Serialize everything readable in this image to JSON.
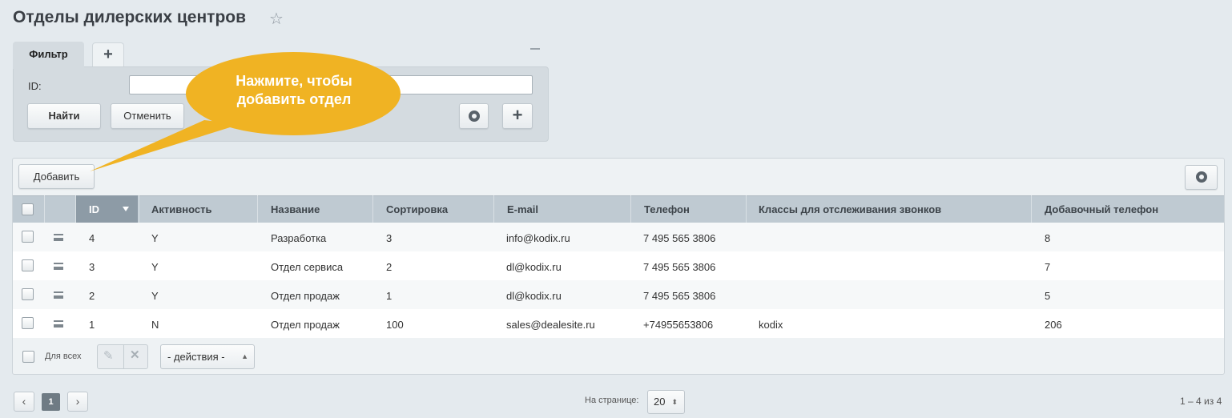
{
  "page": {
    "title": "Отделы дилерских центров"
  },
  "filter": {
    "tab_label": "Фильтр",
    "id_label": "ID:",
    "id_value": "",
    "find_label": "Найти",
    "cancel_label": "Отменить"
  },
  "callout": {
    "line1": "Нажмите, чтобы",
    "line2": "добавить отдел"
  },
  "toolbar": {
    "add_label": "Добавить"
  },
  "grid": {
    "columns": [
      "ID",
      "Активность",
      "Название",
      "Сортировка",
      "E-mail",
      "Телефон",
      "Классы для отслеживания звонков",
      "Добавочный телефон"
    ],
    "rows": [
      {
        "id": "4",
        "active": "Y",
        "name": "Разработка",
        "sort": "3",
        "email": "info@kodix.ru",
        "phone": "7 495 565 3806",
        "classes": "",
        "ext": "8"
      },
      {
        "id": "3",
        "active": "Y",
        "name": "Отдел сервиса",
        "sort": "2",
        "email": "dl@kodix.ru",
        "phone": "7 495 565 3806",
        "classes": "",
        "ext": "7"
      },
      {
        "id": "2",
        "active": "Y",
        "name": "Отдел продаж",
        "sort": "1",
        "email": "dl@kodix.ru",
        "phone": "7 495 565 3806",
        "classes": "",
        "ext": "5"
      },
      {
        "id": "1",
        "active": "N",
        "name": "Отдел продаж",
        "sort": "100",
        "email": "sales@dealesite.ru",
        "phone": "+74955653806",
        "classes": "kodix",
        "ext": "206"
      }
    ],
    "for_all_label": "Для всех",
    "actions_label": "- действия -"
  },
  "pager": {
    "current_page": "1",
    "per_page_label": "На странице:",
    "per_page_value": "20",
    "range_text": "1 – 4 из 4"
  },
  "colors": {
    "accent_callout": "#f0b323",
    "header_active": "#8d9ba6"
  }
}
